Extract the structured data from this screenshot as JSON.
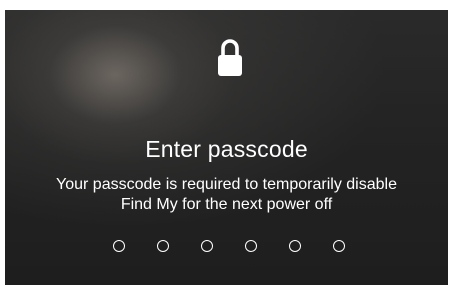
{
  "lock_screen": {
    "icon": "lock-icon",
    "title": "Enter passcode",
    "message_line1": "Your passcode is required to temporarily disable",
    "message_line2": "Find My for the next power off"
  },
  "passcode": {
    "length": 6,
    "entered": 0
  },
  "colors": {
    "text": "#ffffff",
    "background": "#232323"
  }
}
